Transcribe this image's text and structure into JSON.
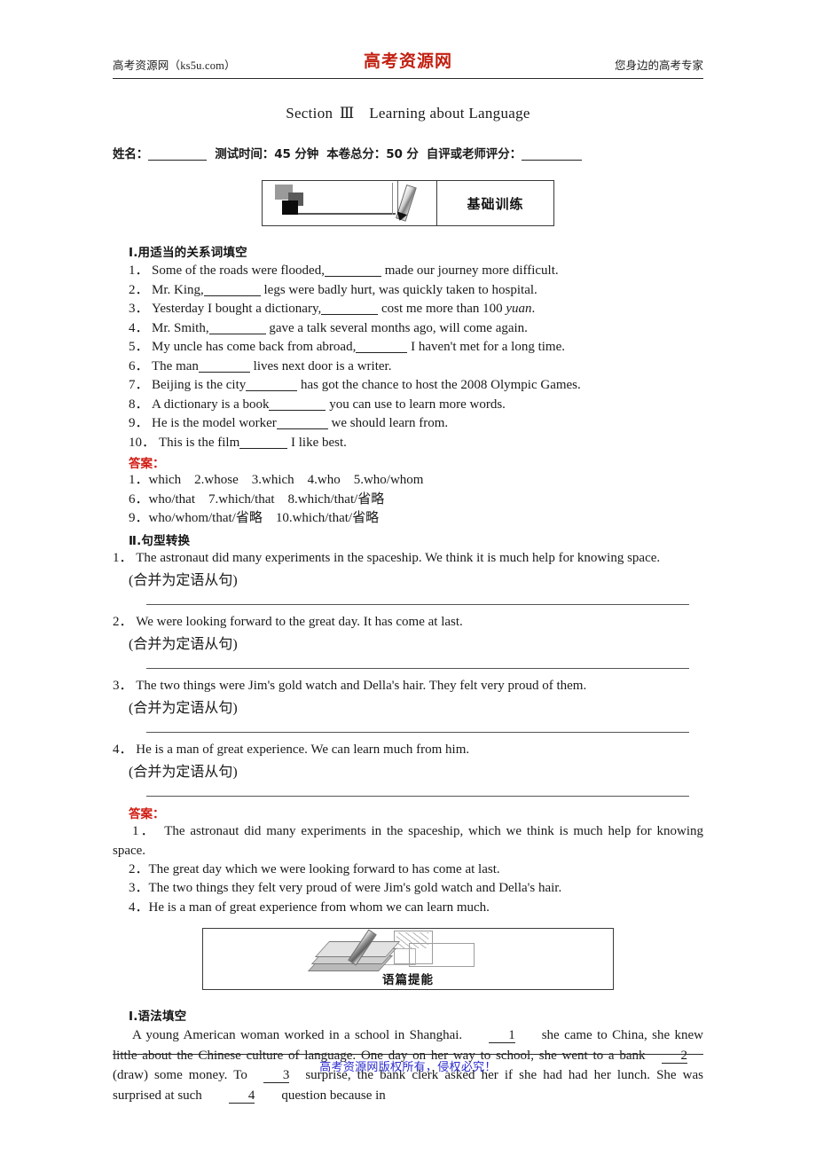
{
  "header": {
    "left": "高考资源网（ks5u.com）",
    "logo": "高考资源网",
    "right": "您身边的高考专家"
  },
  "title": {
    "prefix": "Section",
    "numeral": "Ⅲ",
    "name": "Learning about Language"
  },
  "meta": {
    "name_label": "姓名：",
    "time_label": "测试时间：45 分钟",
    "total_label": "本卷总分：50 分",
    "score_label": "自评或老师评分："
  },
  "banner1": {
    "label": "基础训练",
    "art": "pencil-writing-icon"
  },
  "banner2": {
    "label": "语篇提能",
    "art": "books-pencil-icon"
  },
  "section1": {
    "heading": "Ⅰ.用适当的关系词填空",
    "items": [
      {
        "n": "1．",
        "before": "Some of the roads were flooded,",
        "after": "made our journey more difficult."
      },
      {
        "n": "2．",
        "before": "Mr. King,",
        "after": "legs were badly hurt, was quickly taken to hospital."
      },
      {
        "n": "3．",
        "before": "Yesterday I bought a dictionary,",
        "after": "cost me more than 100 ",
        "italic": "yuan",
        "tail": "."
      },
      {
        "n": "4．",
        "before": "Mr. Smith,",
        "after": "gave a talk several months ago, will come again."
      },
      {
        "n": "5．",
        "before": "My uncle has come back from abroad,",
        "after": "I haven't met for a long time."
      },
      {
        "n": "6．",
        "before": "The man",
        "after": "lives next door is a writer."
      },
      {
        "n": "7．",
        "before": "Beijing is the city",
        "after": "has got the chance to host the 2008 Olympic Games."
      },
      {
        "n": "8．",
        "before": "A dictionary is a book",
        "after": "you can use to learn more words."
      },
      {
        "n": "9．",
        "before": "He is the model worker",
        "after": "we should learn from."
      },
      {
        "n": "10．",
        "before": "This is the film",
        "after": "I like best."
      }
    ],
    "answer_title": "答案：",
    "answer_rows": [
      "1．which　2.whose　3.which　4.who　5.who/whom",
      "6．who/that　7.which/that　8.which/that/省略",
      "9．who/whom/that/省略　10.which/that/省略"
    ]
  },
  "section2": {
    "heading": "Ⅱ.句型转换",
    "items": [
      {
        "n": "1．",
        "text": "The astronaut did many experiments in the spaceship. We think it is much help for knowing space.",
        "hint": "(合并为定语从句)"
      },
      {
        "n": "2．",
        "text": "We were looking forward to the great day. It has come at last.",
        "hint": "(合并为定语从句)"
      },
      {
        "n": "3．",
        "text": "The two things were Jim's gold watch and Della's hair. They felt very proud of them.",
        "hint": "(合并为定语从句)"
      },
      {
        "n": "4．",
        "text": "He is a man of great experience. We can learn much from him.",
        "hint": "(合并为定语从句)"
      }
    ],
    "answer_title": "答案：",
    "answers": [
      "1．　The astronaut did many experiments in the spaceship, which we think is much help for knowing space.",
      "2．The great day which we were looking forward to has come at last.",
      "3．The two things they felt very proud of were Jim's gold watch and Della's hair.",
      "4．He is a man of great experience from whom we can learn much."
    ]
  },
  "section3": {
    "heading": "Ⅰ.语法填空",
    "passage_parts": [
      "A young American woman worked in a school in Shanghai.",
      "she came to China, she knew little about the Chinese culture of language. One day on her way to school, she went to a bank",
      "(draw) some money. To",
      "surprise, the bank clerk asked her if she had had her lunch. She was surprised at such",
      "question because in"
    ],
    "blanks": [
      "1",
      "2",
      "3",
      "4"
    ]
  },
  "footer": {
    "text": "高考资源网版权所有，侵权必究！"
  },
  "colors": {
    "logo_red": "#c21f10",
    "answer_red": "#d01a10",
    "footer_blue": "#2b2bcc",
    "rule": "#2a2a2a"
  }
}
